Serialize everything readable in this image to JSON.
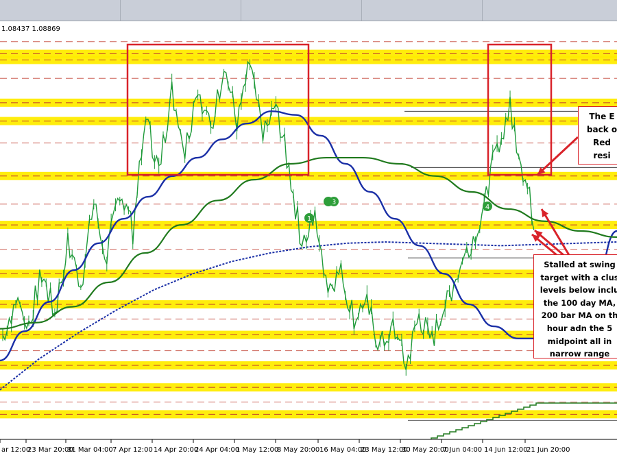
{
  "window": {
    "ohlc_readout": "1.08437 1.08869"
  },
  "annotations": {
    "top": [
      "The E",
      "back o",
      "Red",
      "resi"
    ],
    "bottom": [
      "Stalled at swing",
      "target with a clus",
      "levels below inclu",
      "the 100 day MA,",
      "200 bar MA on th",
      "hour adn the 5",
      "midpoint all in",
      "narrow  range"
    ]
  },
  "markers": [
    "1",
    "3",
    "4"
  ],
  "colors": {
    "price": "#1f9a3a",
    "ma_blue": "#1a2fa6",
    "ma_green": "#207a1e",
    "ma_steps": "#1a2fa6",
    "zones": "#ffec00",
    "boxes": "#d9232a",
    "marker": "#2e9e3a"
  },
  "chart_data": {
    "type": "line",
    "x_tick_labels": [
      "ar 12:00",
      "23 Mar 20:00",
      "31 Mar 04:00",
      "7 Apr 12:00",
      "14 Apr 20:00",
      "24 Apr 04:00",
      "1 May 12:00",
      "8 May 20:00",
      "16 May 04:00",
      "23 May 12:00",
      "30 May 20:00",
      "7 Jun 04:00",
      "14 Jun 12:00",
      "21 Jun 20:00"
    ],
    "price_close": [
      1.0855,
      1.0882,
      1.0865,
      1.0905,
      1.0872,
      1.093,
      1.0895,
      1.0962,
      1.0918,
      1.0975,
      1.094,
      1.1032,
      1.099,
      1.1055,
      1.1005,
      1.106,
      1.102,
      1.1075,
      1.103,
      1.1078,
      1.1015,
      1.1045,
      1.099,
      1.093,
      1.095,
      1.0895,
      1.0905,
      1.087,
      1.088,
      1.0845,
      1.0862,
      1.083,
      1.087,
      1.085,
      1.088,
      1.0905,
      1.0932,
      1.096,
      1.101,
      1.104,
      1.099,
      1.0942
    ],
    "ma_blue": [
      1.0834,
      1.0858,
      1.0882,
      1.0908,
      1.093,
      1.095,
      1.0968,
      1.0985,
      1.1,
      1.1015,
      1.1028,
      1.1038,
      1.1035,
      1.1018,
      1.0995,
      1.0972,
      1.095,
      1.0928,
      1.0905,
      1.088,
      1.0862,
      1.0852,
      1.0852,
      1.0862,
      1.089,
      1.094
    ],
    "ma_green": [
      1.086,
      1.0865,
      1.0878,
      1.0898,
      1.0922,
      1.0945,
      1.0965,
      1.0982,
      1.0995,
      1.1,
      1.1,
      1.0995,
      1.0985,
      1.0972,
      1.0958,
      1.0948,
      1.094,
      1.0935
    ],
    "ma_100_day": [
      1.081,
      1.0835,
      1.0856,
      1.0875,
      1.0892,
      1.0905,
      1.0915,
      1.0922,
      1.0927,
      1.093,
      1.0931,
      1.093,
      1.0929,
      1.0928,
      1.0929,
      1.093,
      1.0931
    ],
    "support_resistance_levels": [
      1.1085,
      1.108,
      1.1045,
      1.103,
      1.0985,
      1.0945,
      1.0905,
      1.088,
      1.0855,
      1.083,
      1.0812,
      1.079
    ],
    "ylim": [
      1.077,
      1.111
    ],
    "grid": false,
    "legend": "none"
  }
}
